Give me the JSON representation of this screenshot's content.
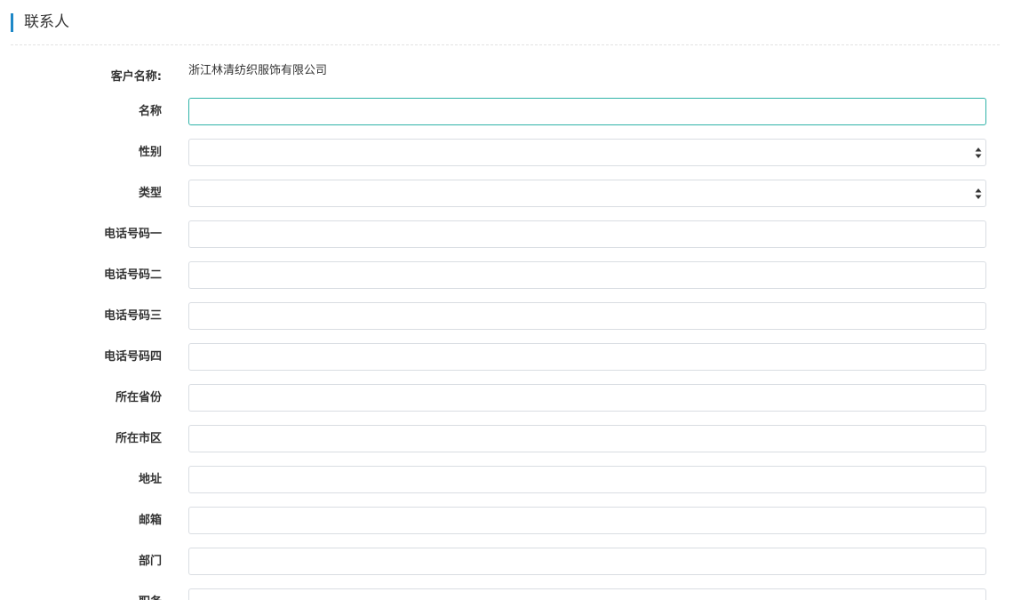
{
  "section": {
    "title": "联系人"
  },
  "customer": {
    "label": "客户名称:",
    "value": "浙江林清纺织服饰有限公司"
  },
  "fields": [
    {
      "label": "名称",
      "value": "",
      "kind": "input"
    },
    {
      "label": "性别",
      "value": "",
      "kind": "select"
    },
    {
      "label": "类型",
      "value": "",
      "kind": "select"
    },
    {
      "label": "电话号码一",
      "value": "",
      "kind": "input"
    },
    {
      "label": "电话号码二",
      "value": "",
      "kind": "input"
    },
    {
      "label": "电话号码三",
      "value": "",
      "kind": "input"
    },
    {
      "label": "电话号码四",
      "value": "",
      "kind": "input"
    },
    {
      "label": "所在省份",
      "value": "",
      "kind": "input"
    },
    {
      "label": "所在市区",
      "value": "",
      "kind": "input"
    },
    {
      "label": "地址",
      "value": "",
      "kind": "input"
    },
    {
      "label": "邮箱",
      "value": "",
      "kind": "input"
    },
    {
      "label": "部门",
      "value": "",
      "kind": "input"
    },
    {
      "label": "职务",
      "value": "",
      "kind": "input"
    }
  ],
  "colors": {
    "accent": "#1e88c7",
    "focus_border": "#2fb3a8",
    "border": "#d9dde2"
  }
}
